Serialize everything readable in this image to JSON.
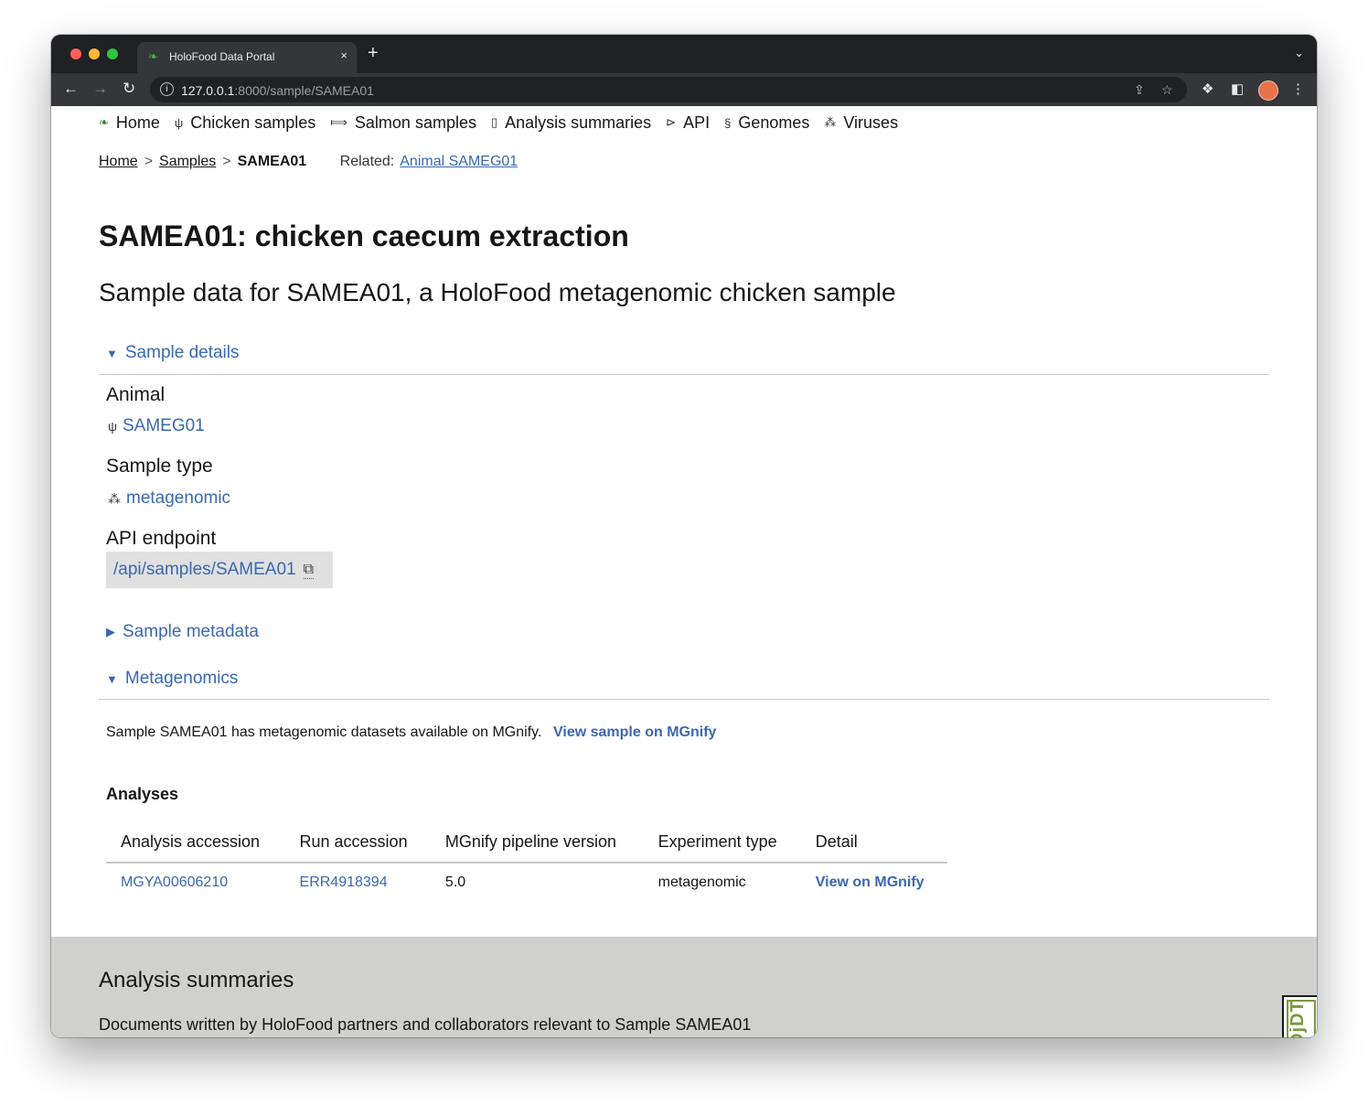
{
  "browser": {
    "tab_title": "HoloFood Data Portal",
    "new_tab": "+",
    "tab_close": "×",
    "url_host": "127.0.0.1",
    "url_rest": ":8000/sample/SAMEA01"
  },
  "nav": {
    "items": [
      {
        "label": "Home",
        "icon": "logo-icon"
      },
      {
        "label": "Chicken samples",
        "icon": "chicken-icon"
      },
      {
        "label": "Salmon samples",
        "icon": "fish-icon"
      },
      {
        "label": "Analysis summaries",
        "icon": "book-icon"
      },
      {
        "label": "API",
        "icon": "terminal-icon"
      },
      {
        "label": "Genomes",
        "icon": "dna-icon"
      },
      {
        "label": "Viruses",
        "icon": "virus-icon"
      }
    ]
  },
  "breadcrumb": {
    "home": "Home",
    "samples": "Samples",
    "current": "SAMEA01",
    "sep": ">",
    "related_label": "Related:",
    "related_link": "Animal SAMEG01"
  },
  "page": {
    "title": "SAMEA01: chicken caecum extraction",
    "subtitle": "Sample data for SAMEA01, a HoloFood metagenomic chicken sample"
  },
  "sample_details": {
    "summary": "Sample details",
    "animal_label": "Animal",
    "animal_value": "SAMEG01",
    "type_label": "Sample type",
    "type_value": "metagenomic",
    "api_label": "API endpoint",
    "api_value": "/api/samples/SAMEA01"
  },
  "sample_metadata": {
    "summary": "Sample metadata"
  },
  "metagenomics": {
    "summary": "Metagenomics",
    "text": "Sample SAMEA01 has metagenomic datasets available on MGnify.",
    "link": "View sample on MGnify",
    "analyses_heading": "Analyses",
    "headers": [
      "Analysis accession",
      "Run accession",
      "MGnify pipeline version",
      "Experiment type",
      "Detail"
    ],
    "rows": [
      [
        "MGYA00606210",
        "ERR4918394",
        "5.0",
        "metagenomic",
        "View on MGnify"
      ]
    ]
  },
  "summaries_section": {
    "heading": "Analysis summaries",
    "text": "Documents written by HoloFood partners and collaborators relevant to Sample SAMEA01"
  },
  "debug_toolbar": {
    "label": "DjDT"
  },
  "colors": {
    "link": "#3a68b0",
    "chrome_dark": "#202124",
    "chrome_mid": "#35363a",
    "footer_bg": "#d0d0cf"
  }
}
